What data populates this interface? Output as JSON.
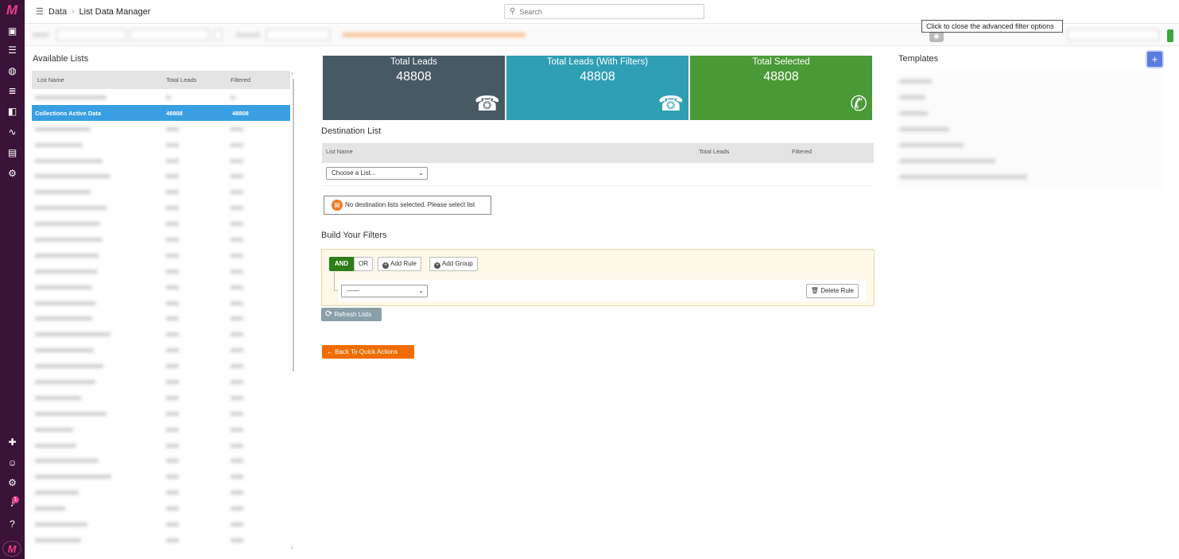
{
  "app": {
    "logo_text": "M"
  },
  "breadcrumb": {
    "section": "Data",
    "separator": "›",
    "current": "List Data Manager"
  },
  "search": {
    "placeholder": "Search"
  },
  "filter_strip": {
    "tooltip": "Click to close the advanced filter options"
  },
  "notifications": {
    "count": "1"
  },
  "available_lists": {
    "title": "Available Lists",
    "columns": [
      "List Name",
      "Total Leads",
      "Filtered"
    ],
    "selected_row": {
      "name": "Collections Active Data",
      "total": "48808",
      "filtered": "48808"
    }
  },
  "stats": [
    {
      "title": "Total Leads",
      "value": "48808",
      "color": "#475963",
      "icon": "phone-icon"
    },
    {
      "title": "Total Leads (With Filters)",
      "value": "48808",
      "color": "#2f9fb4",
      "icon": "phone-icon"
    },
    {
      "title": "Total Selected",
      "value": "48808",
      "color": "#4a9a37",
      "icon": "phone-ringing-icon"
    }
  ],
  "destination": {
    "title": "Destination List",
    "columns": [
      "List Name",
      "Total Leads",
      "Filtered"
    ],
    "select_value": "Choose a List...",
    "alert": "No destination lists selected. Please select list"
  },
  "filters": {
    "title": "Build Your Filters",
    "and_label": "AND",
    "or_label": "OR",
    "add_rule": "Add Rule",
    "add_group": "Add Group",
    "rule_select": "------",
    "delete_rule": "Delete Rule"
  },
  "actions": {
    "refresh": "Refresh Lists",
    "back": "Back To Quick Actions"
  },
  "templates": {
    "title": "Templates",
    "add_label": "+"
  }
}
